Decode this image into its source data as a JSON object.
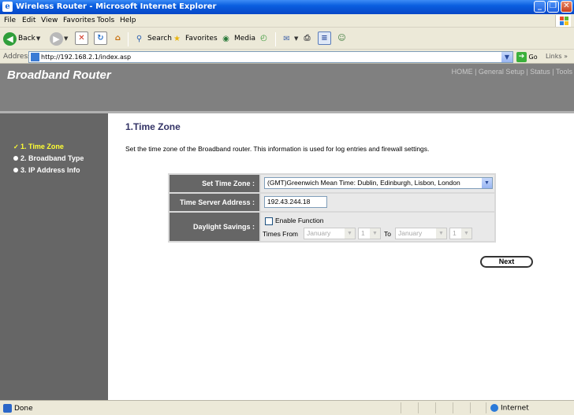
{
  "window": {
    "title": "Wireless Router - Microsoft Internet Explorer"
  },
  "menu": [
    "File",
    "Edit",
    "View",
    "Favorites",
    "Tools",
    "Help"
  ],
  "toolbar": {
    "back": "Back",
    "search": "Search",
    "favorites": "Favorites",
    "media": "Media"
  },
  "address": {
    "label": "Address",
    "url": "http://192.168.2.1/index.asp",
    "go": "Go",
    "links": "Links"
  },
  "header": {
    "brand": "Broadband Router",
    "topnav": "HOME | General Setup | Status | Tools"
  },
  "sidebar": {
    "items": [
      {
        "label": "1. Time Zone",
        "active": true
      },
      {
        "label": "2. Broadband Type",
        "active": false
      },
      {
        "label": "3. IP Address Info",
        "active": false
      }
    ]
  },
  "content": {
    "heading": "1.Time Zone",
    "description": "Set the time zone of the Broadband router. This information is used for log entries and firewall settings."
  },
  "form": {
    "timezone_label": "Set Time Zone :",
    "timezone_value": "(GMT)Greenwich Mean Time: Dublin, Edinburgh, Lisbon, London",
    "server_label": "Time Server Address :",
    "server_value": "192.43.244.18",
    "dst_label": "Daylight Savings :",
    "dst_enable": "Enable Function",
    "dst_enabled": false,
    "times_from": "Times From",
    "from_month": "January",
    "from_day": "1",
    "to": "To",
    "to_month": "January",
    "to_day": "1"
  },
  "next_button": "Next",
  "status": {
    "text": "Done",
    "zone": "Internet"
  }
}
